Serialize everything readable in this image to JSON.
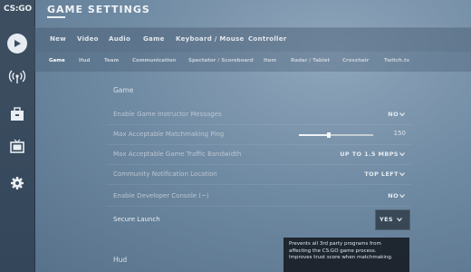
{
  "app": {
    "logo_text": "CS:GO",
    "title": "GAME SETTINGS"
  },
  "tabs": [
    "New",
    "Video",
    "Audio",
    "Game",
    "Keyboard / Mouse",
    "Controller"
  ],
  "subtabs": [
    "Game",
    "Hud",
    "Team",
    "Communication",
    "Spectator / Scoreboard",
    "Item",
    "Radar / Tablet",
    "Crosshair",
    "Twitch.tv"
  ],
  "sidebar": {
    "items": [
      "play-icon",
      "broadcast-icon",
      "inventory-icon",
      "tv-icon",
      "gear-icon"
    ]
  },
  "section": {
    "title": "Game",
    "next_title": "Hud"
  },
  "settings": [
    {
      "label": "Enable Game Instructor Messages",
      "value": "NO"
    },
    {
      "label": "Max Acceptable Matchmaking Ping",
      "value": "150",
      "slider": 0.4
    },
    {
      "label": "Max Acceptable Game Traffic Bandwidth",
      "value": "UP TO 1.5 MBPS"
    },
    {
      "label": "Community Notification Location",
      "value": "TOP LEFT"
    },
    {
      "label": "Enable Developer Console (~)",
      "value": "NO"
    },
    {
      "label": "Secure Launch",
      "value": "YES"
    }
  ],
  "tooltip": {
    "line1": "Prevents all 3rd party programs from",
    "line2": "affecting the CS:GO game process.",
    "line3": "Improves trust score when matchmaking."
  }
}
